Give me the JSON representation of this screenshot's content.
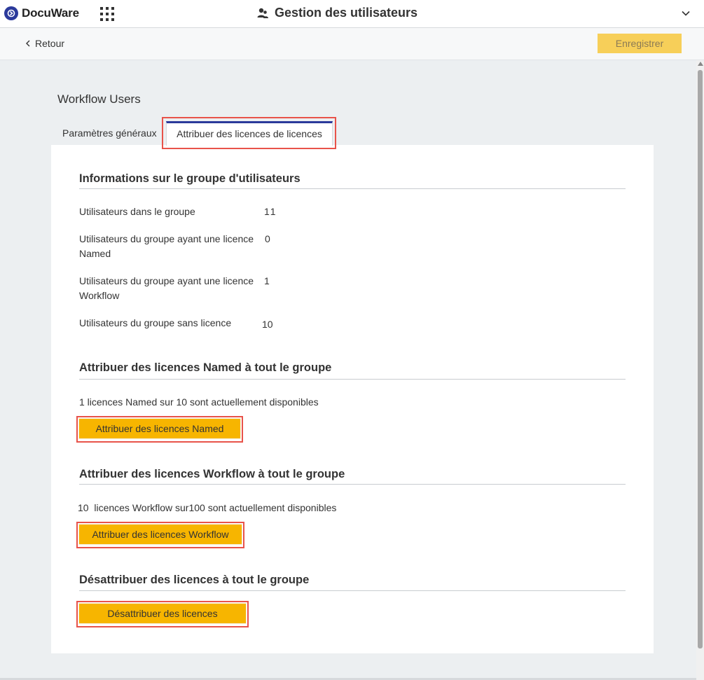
{
  "topbar": {
    "logo_text": "DocuWare",
    "title": "Gestion des utilisateurs",
    "icons": {
      "apps": "apps-grid-icon",
      "title": "users-icon",
      "menu": "chevron-down-icon"
    }
  },
  "toolbar": {
    "back_label": "Retour",
    "save_label": "Enregistrer"
  },
  "page": {
    "heading": "Workflow Users",
    "tabs": [
      {
        "label": "Paramètres généraux",
        "active": false
      },
      {
        "label": "Attribuer des licences de licences",
        "active": true
      }
    ]
  },
  "group_info": {
    "title": "Informations sur le groupe d'utilisateurs",
    "rows": [
      {
        "label": "Utilisateurs dans le groupe",
        "value": "11"
      },
      {
        "label": "Utilisateurs du groupe ayant une licence Named",
        "value": "0"
      },
      {
        "label": "Utilisateurs du groupe ayant une licence Workflow",
        "value": "1"
      },
      {
        "label": "Utilisateurs du groupe sans licence",
        "value": "10"
      }
    ]
  },
  "named_section": {
    "title": "Attribuer des licences Named à tout le groupe",
    "availability": "1 licences Named sur 10 sont actuellement disponibles",
    "button_label": "Attribuer des licences Named"
  },
  "workflow_section": {
    "title": "Attribuer des licences Workflow à tout le groupe",
    "availability": "10  licences Workflow sur100 sont actuellement disponibles",
    "button_label": "Attribuer des licences Workflow"
  },
  "unassign_section": {
    "title": "Désattribuer des licences à tout le groupe",
    "button_label": "Désattribuer des licences"
  },
  "colors": {
    "accent": "#2b3a9b",
    "button_yellow": "#f7b500",
    "save_disabled": "#f7cf59",
    "highlight": "#e8534a"
  }
}
